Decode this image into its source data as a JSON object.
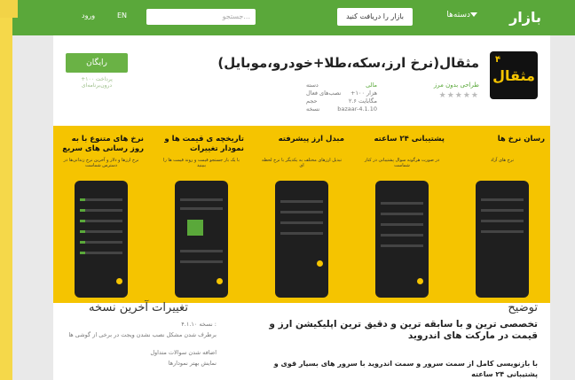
{
  "topbar": {
    "logo": "بازار",
    "categories": "دسته‌ها",
    "login": "بازار را دریافت کنید",
    "search_placeholder": "جستجو...",
    "lang": "EN",
    "enter": "ورود"
  },
  "app": {
    "icon_text": "مثقال",
    "icon_num": "۴",
    "title": "مثقال(نرخ ارز،سکه،طلا+خودرو،موبایل)",
    "developer": "طراحی بدون مرز",
    "stars": "★★★★★",
    "info": [
      {
        "k": "دسته",
        "v": "مالی"
      },
      {
        "k": "نصب‌های فعال",
        "v": "+۱۰۰ هزار"
      },
      {
        "k": "حجم",
        "v": "۲.۶ مگابایت"
      },
      {
        "k": "نسخه",
        "v": "bazaar-4.1.10"
      }
    ],
    "install": "رایگان",
    "install_note": "+۱۰۰ پرداخت درون‌برنامه‌ای"
  },
  "screenshots": [
    {
      "title": "نرخ های متنوع با به روز رسانی های سریع",
      "sub": "نرخ ارزها و دلار و آخرین نرخ زندانی‌ها در دسترس شماست"
    },
    {
      "title": "تاریخچه ی قیمت ها و نمودار تغییرات",
      "sub": "با یک بار جستجو قیمت و روند قیمت ها را ببینید"
    },
    {
      "title": "مبدل ارز پیشرفته",
      "sub": "تبدیل ارزهای مختلف به یکدیگر با نرخ لحظه ای"
    },
    {
      "title": "پشتیبانی ۲۴ ساعته",
      "sub": "در صورت هرگونه سوال پشتیبانی در کنار شماست"
    },
    {
      "title": "رسان نرخ ها",
      "sub": "نرخ های آزاد"
    }
  ],
  "changelog": {
    "heading": "تغییرات آخرین نسخه",
    "items": [
      "نسخه ۴.۱.۱۰ :",
      "برطرف شدن مشکل نصب نشدن ویجت در برخی از گوشی ها",
      "اضافه شدن سوالات متداول",
      "نمایش بهتر نمودارها"
    ]
  },
  "description": {
    "heading": "توضیح",
    "line1": "تخصصی ترین و با سابقه ترین و دقیق ترین اپلیکیشن ارز و",
    "line2": "قیمت در مارکت های اندروید",
    "line3": "با بازنویسی کامل از سمت سرور و سمت اندروید با سرور های بسیار قوی و",
    "line4": "پشتیبانی ۲۴ ساعته"
  },
  "colors": {
    "accent": "#5aa83a",
    "shot_bg": "#f5c400"
  }
}
